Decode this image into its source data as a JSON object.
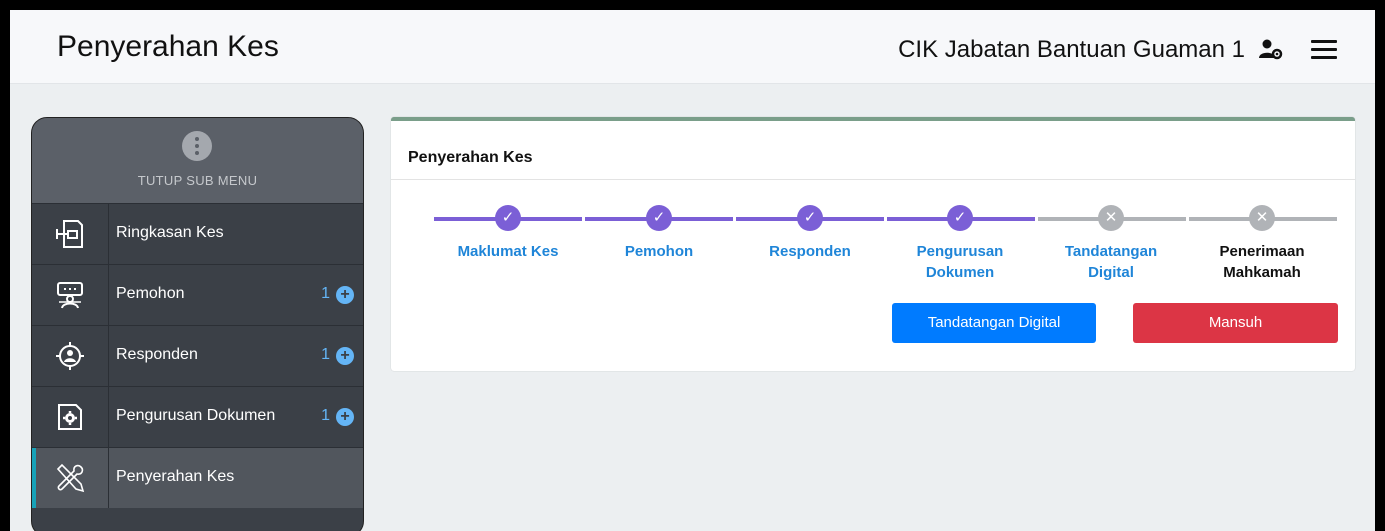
{
  "header": {
    "title": "Penyerahan Kes",
    "user": "CIK Jabatan Bantuan Guaman 1"
  },
  "sidebar": {
    "toggle_label": "TUTUP SUB MENU",
    "items": [
      {
        "label": "Ringkasan Kes",
        "count": "",
        "icon": "document-export-icon"
      },
      {
        "label": "Pemohon",
        "count": "1",
        "icon": "presenter-icon"
      },
      {
        "label": "Responden",
        "count": "1",
        "icon": "target-user-icon"
      },
      {
        "label": "Pengurusan Dokumen",
        "count": "1",
        "icon": "document-settings-icon"
      },
      {
        "label": "Penyerahan Kes",
        "count": "",
        "icon": "tools-icon"
      }
    ],
    "active_index": 4
  },
  "panel": {
    "title": "Penyerahan Kes",
    "steps": [
      {
        "label_1": "Maklumat Kes",
        "label_2": "",
        "status": "done"
      },
      {
        "label_1": "Pemohon",
        "label_2": "",
        "status": "done"
      },
      {
        "label_1": "Responden",
        "label_2": "",
        "status": "done"
      },
      {
        "label_1": "Pengurusan",
        "label_2": "Dokumen",
        "status": "done"
      },
      {
        "label_1": "Tandatangan",
        "label_2": "Digital",
        "status": "pending"
      },
      {
        "label_1": "Penerimaan",
        "label_2": "Mahkamah",
        "status": "pending"
      }
    ],
    "primary_button": "Tandatangan Digital",
    "danger_button": "Mansuh"
  },
  "colors": {
    "step_done": "#7b5fd6",
    "step_pending": "#b0b3b7",
    "accent_blue": "#007bff",
    "danger_red": "#dc3545",
    "sidebar_bg": "#3b4047",
    "active_indicator": "#17a2b8"
  }
}
